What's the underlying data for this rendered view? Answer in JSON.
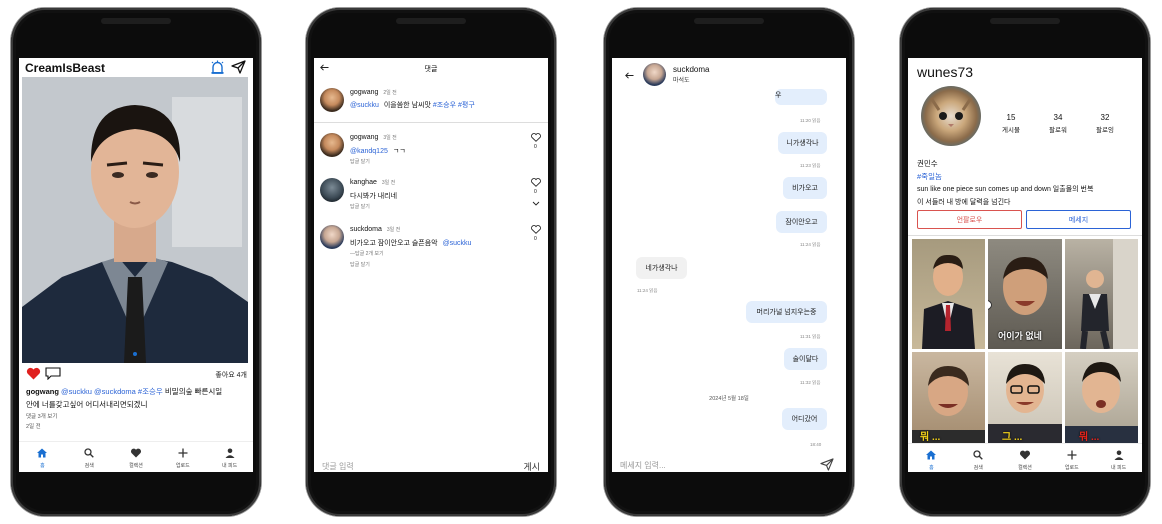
{
  "feed": {
    "app_title": "CreamIsBeast",
    "likes": "좋아요 4개",
    "caption_user": "gogwang",
    "caption_tags": "@suckku @suckdoma #조승우",
    "caption_text1": "비밀의숲 빠른시일",
    "caption_text2": "안에 너를갖고싶어 어디서내리면되겠니",
    "view_comments": "댓글 3개 보기",
    "time": "2일 전"
  },
  "nav": {
    "home": "홈",
    "search": "검색",
    "collection": "컬렉션",
    "upload": "업로드",
    "my_feed": "내 피드"
  },
  "comments": {
    "title": "댓글",
    "post_user": "gogwang",
    "post_time": "2일 전",
    "post_mention": "@suckku",
    "post_text": "이을씀한 남씨맛",
    "post_tags": "#조승우 #평구",
    "items": [
      {
        "user": "gogwang",
        "time": "3일 전",
        "mention": "@kandq125",
        "text": "ㄱㄱ",
        "reply": "답글 달기",
        "likes": "0"
      },
      {
        "user": "kanghae",
        "time": "3일 전",
        "text": "다시봐가 내리네",
        "reply": "답글 달기",
        "likes": "0"
      },
      {
        "user": "suckdoma",
        "time": "3일 전",
        "text": "비가오고 잠이안오고 슬픈음악",
        "mention": "@suckku",
        "more": "—답글 2개 보기",
        "reply": "답글 달기",
        "likes": "0"
      }
    ],
    "input_placeholder": "댓글 입력",
    "post_button": "게시"
  },
  "chat": {
    "user": "suckdoma",
    "sub": "마석도",
    "top_cut": "비밀의숲라 조승우",
    "messages": [
      {
        "text": "니가생각나",
        "time": "11:23 읽음"
      },
      {
        "text": "비가오고",
        "time": ""
      },
      {
        "text": "잠이안오고",
        "time": "11:24 읽음"
      },
      {
        "text": "네가생각나",
        "time": "11:24 읽음"
      },
      {
        "text": "머리가널 넘지우는중",
        "time": "11:31 읽음"
      },
      {
        "text": "술이달다",
        "time": "11:32 읽음"
      },
      {
        "text": "어디갔어",
        "time": "18:40"
      }
    ],
    "top_time": "11:20 읽음",
    "date_divider": "2024년 5월 18일",
    "input_placeholder": "메세지 입력..."
  },
  "profile": {
    "username": "wunes73",
    "posts_count": "15",
    "posts_label": "게시물",
    "followers_count": "34",
    "followers_label": "팔로워",
    "following_count": "32",
    "following_label": "팔로잉",
    "name": "권민수",
    "tag": "#죽일놈",
    "bio1": "sun like one piece sun comes up and down 일출몰의 번복",
    "bio2": "이 서들러 내 방에 달력을 넘긴다",
    "unfollow": "언팔로우",
    "message": "메세지",
    "grid_caption1": "어이가 없네",
    "grid_caption2": "뭐 ...",
    "grid_caption3": "그 ...",
    "grid_caption4": "뭐 ..."
  },
  "colors": {
    "accent": "#1a6fd1",
    "heart": "#e0201e",
    "link": "#2b63d6",
    "unfollow_red": "#d9534f"
  }
}
